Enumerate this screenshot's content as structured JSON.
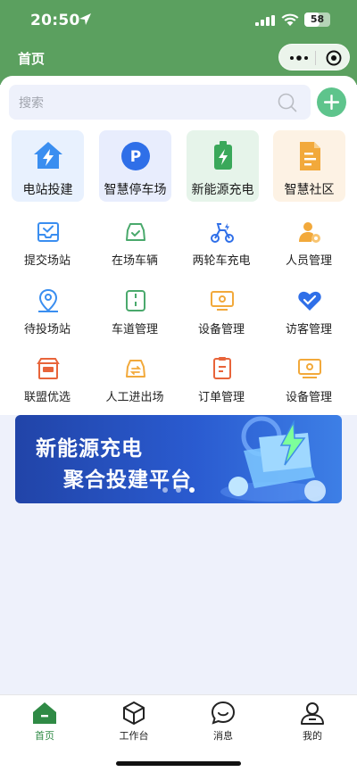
{
  "status_bar": {
    "time": "20:50",
    "battery": "58",
    "battery_level": 0.58
  },
  "header": {
    "title": "首页",
    "bg": "#5ba05f"
  },
  "search": {
    "placeholder": "搜索"
  },
  "featured": [
    {
      "label": "电站投建",
      "icon": "house-bolt-icon",
      "bg": "#e8f1fe"
    },
    {
      "label": "智慧停车场",
      "icon": "parking-icon",
      "bg": "#e8edfd"
    },
    {
      "label": "新能源充电",
      "icon": "battery-charge-icon",
      "bg": "#e6f4ea"
    },
    {
      "label": "智慧社区",
      "icon": "document-icon",
      "bg": "#fdf2e4"
    }
  ],
  "grid": [
    {
      "label": "提交场站",
      "icon": "inbox-check-icon"
    },
    {
      "label": "在场车辆",
      "icon": "car-check-icon"
    },
    {
      "label": "两轮车充电",
      "icon": "ebike-icon"
    },
    {
      "label": "人员管理",
      "icon": "user-gear-icon"
    },
    {
      "label": "待投场站",
      "icon": "location-user-icon"
    },
    {
      "label": "车道管理",
      "icon": "lane-icon"
    },
    {
      "label": "设备管理",
      "icon": "monitor-icon"
    },
    {
      "label": "访客管理",
      "icon": "handshake-icon"
    },
    {
      "label": "联盟优选",
      "icon": "shop-icon"
    },
    {
      "label": "人工进出场",
      "icon": "car-swap-icon"
    },
    {
      "label": "订单管理",
      "icon": "order-icon"
    },
    {
      "label": "设备管理",
      "icon": "device-gear-icon"
    }
  ],
  "banner": {
    "line1": "新能源充电",
    "line2": "聚合投建平台",
    "page_count": 3,
    "active_page": 3
  },
  "tabs": [
    {
      "label": "首页",
      "icon": "home-icon",
      "active": true
    },
    {
      "label": "工作台",
      "icon": "cube-icon",
      "active": false
    },
    {
      "label": "消息",
      "icon": "chat-icon",
      "active": false
    },
    {
      "label": "我的",
      "icon": "profile-icon",
      "active": false
    }
  ],
  "colors": {
    "primary": "#5ba05f",
    "accent_green": "#5ec48c",
    "tab_active": "#2f8a45"
  }
}
